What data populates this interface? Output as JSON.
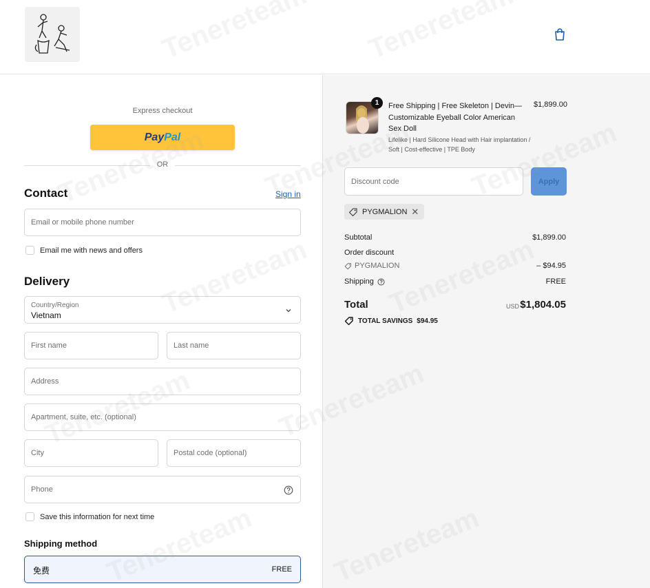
{
  "header": {
    "logo_icon": "illustrated-figures-logo",
    "cart_icon": "shopping-bag-icon"
  },
  "checkout": {
    "express_label": "Express checkout",
    "paypal_part1": "Pay",
    "paypal_part2": "Pal",
    "or_text": "OR",
    "contact": {
      "title": "Contact",
      "signin_label": "Sign in",
      "email_placeholder": "Email or mobile phone number",
      "news_checkbox_label": "Email me with news and offers"
    },
    "delivery": {
      "title": "Delivery",
      "country_label": "Country/Region",
      "country_value": "Vietnam",
      "first_name_placeholder": "First name",
      "last_name_placeholder": "Last name",
      "address_placeholder": "Address",
      "apartment_placeholder": "Apartment, suite, etc. (optional)",
      "city_placeholder": "City",
      "postal_placeholder": "Postal code (optional)",
      "phone_placeholder": "Phone",
      "save_checkbox_label": "Save this information for next time"
    },
    "shipping_method": {
      "title": "Shipping method",
      "option_name": "免费",
      "option_price": "FREE"
    }
  },
  "summary": {
    "product": {
      "quantity": "1",
      "title": "Free Shipping | Free Skeleton | Devin—Customizable Eyeball Color American Sex Doll",
      "variant": "Lifelike | Hard Silicone Head with Hair implantation / Soft | Cost-effective | TPE Body",
      "price": "$1,899.00"
    },
    "discount_placeholder": "Discount code",
    "apply_label": "Apply",
    "applied_code": "PYGMALION",
    "subtotal_label": "Subtotal",
    "subtotal_value": "$1,899.00",
    "order_discount_label": "Order discount",
    "discount_code": "PYGMALION",
    "discount_value": "– $94.95",
    "shipping_label": "Shipping",
    "shipping_value": "FREE",
    "total_label": "Total",
    "currency": "USD",
    "total_value": "$1,804.05",
    "savings_label": "TOTAL SAVINGS",
    "savings_value": "$94.95"
  },
  "watermark_text": "Tenereteam"
}
